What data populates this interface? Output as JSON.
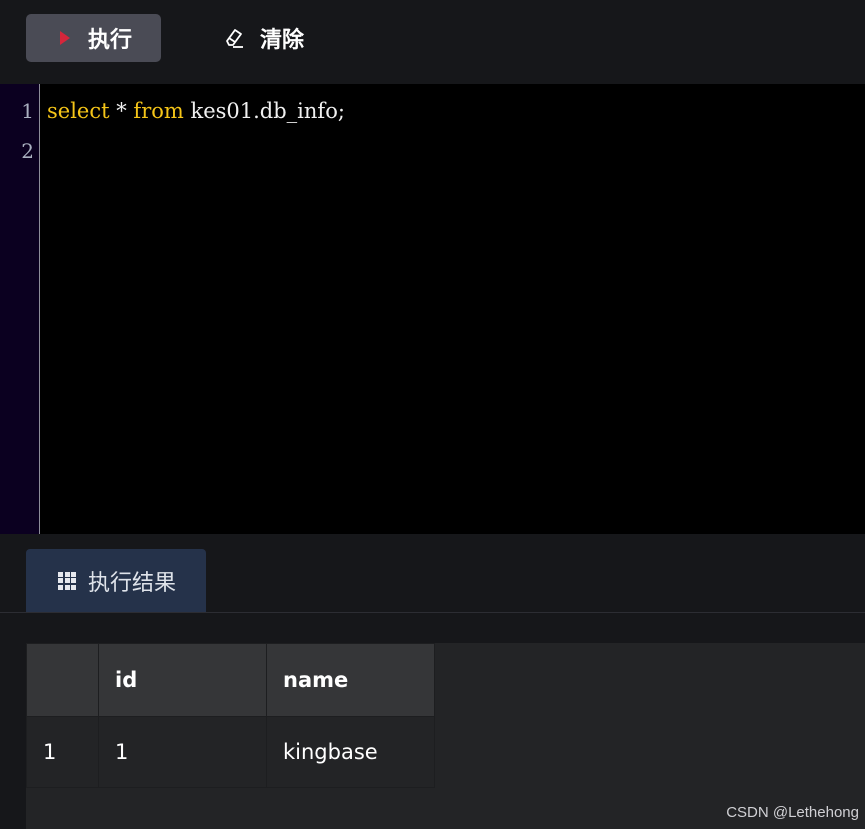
{
  "toolbar": {
    "run_label": "执行",
    "clear_label": "清除",
    "run_icon_color": "#d6263b"
  },
  "editor": {
    "line_numbers": [
      "1",
      "2"
    ],
    "lines": [
      {
        "tokens": [
          {
            "text": "select",
            "kind": "keyword"
          },
          {
            "text": " * ",
            "kind": "plain"
          },
          {
            "text": "from",
            "kind": "keyword"
          },
          {
            "text": " kes01.db_info;",
            "kind": "plain"
          }
        ]
      },
      {
        "tokens": []
      }
    ],
    "keyword_color": "#f5c518"
  },
  "results_tab": {
    "label": "执行结果",
    "icon": "grid-icon"
  },
  "results_table": {
    "columns": [
      "",
      "id",
      "name"
    ],
    "rows": [
      [
        "1",
        "1",
        "kingbase"
      ]
    ]
  },
  "watermark": "CSDN @Lethehong"
}
